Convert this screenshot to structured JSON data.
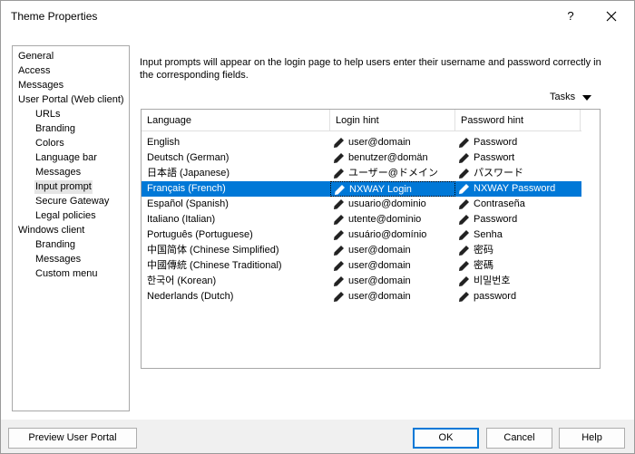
{
  "window": {
    "title": "Theme Properties",
    "help_label": "?"
  },
  "nav": {
    "items": [
      {
        "label": "General",
        "level": 0,
        "selected": false
      },
      {
        "label": "Access",
        "level": 0,
        "selected": false
      },
      {
        "label": "Messages",
        "level": 0,
        "selected": false
      },
      {
        "label": "User Portal (Web client)",
        "level": 0,
        "selected": false
      },
      {
        "label": "URLs",
        "level": 1,
        "selected": false
      },
      {
        "label": "Branding",
        "level": 1,
        "selected": false
      },
      {
        "label": "Colors",
        "level": 1,
        "selected": false
      },
      {
        "label": "Language bar",
        "level": 1,
        "selected": false
      },
      {
        "label": "Messages",
        "level": 1,
        "selected": false
      },
      {
        "label": "Input prompt",
        "level": 1,
        "selected": true
      },
      {
        "label": "Secure Gateway",
        "level": 1,
        "selected": false
      },
      {
        "label": "Legal policies",
        "level": 1,
        "selected": false
      },
      {
        "label": "Windows client",
        "level": 0,
        "selected": false
      },
      {
        "label": "Branding",
        "level": 1,
        "selected": false
      },
      {
        "label": "Messages",
        "level": 1,
        "selected": false
      },
      {
        "label": "Custom menu",
        "level": 1,
        "selected": false
      }
    ]
  },
  "main": {
    "description": "Input prompts will appear on the login page to help users enter their username and password correctly in the corresponding fields.",
    "tasks_label": "Tasks",
    "columns": [
      "Language",
      "Login hint",
      "Password hint"
    ],
    "rows": [
      {
        "language": "English",
        "login_hint": "user@domain",
        "password_hint": "Password",
        "selected": false
      },
      {
        "language": "Deutsch (German)",
        "login_hint": "benutzer@domän",
        "password_hint": "Passwort",
        "selected": false
      },
      {
        "language": "日本語 (Japanese)",
        "login_hint": "ユーザー@ドメイン",
        "password_hint": "パスワード",
        "selected": false
      },
      {
        "language": "Français (French)",
        "login_hint": "NXWAY Login",
        "password_hint": "NXWAY Password",
        "selected": true
      },
      {
        "language": "Español (Spanish)",
        "login_hint": "usuario@dominio",
        "password_hint": "Contraseña",
        "selected": false
      },
      {
        "language": "Italiano (Italian)",
        "login_hint": "utente@dominio",
        "password_hint": "Password",
        "selected": false
      },
      {
        "language": "Português (Portuguese)",
        "login_hint": "usuário@domínio",
        "password_hint": "Senha",
        "selected": false
      },
      {
        "language": "中国简体 (Chinese Simplified)",
        "login_hint": "user@domain",
        "password_hint": "密码",
        "selected": false
      },
      {
        "language": "中國傳統 (Chinese Traditional)",
        "login_hint": "user@domain",
        "password_hint": "密碼",
        "selected": false
      },
      {
        "language": "한국어 (Korean)",
        "login_hint": "user@domain",
        "password_hint": "비밀번호",
        "selected": false
      },
      {
        "language": "Nederlands (Dutch)",
        "login_hint": "user@domain",
        "password_hint": "password",
        "selected": false
      }
    ],
    "edit_icon": "pencil-icon"
  },
  "footer": {
    "preview_label": "Preview User Portal",
    "ok_label": "OK",
    "cancel_label": "Cancel",
    "help_label": "Help"
  },
  "colors": {
    "selection": "#0078d7",
    "nav_selection": "#e5e5e5"
  }
}
